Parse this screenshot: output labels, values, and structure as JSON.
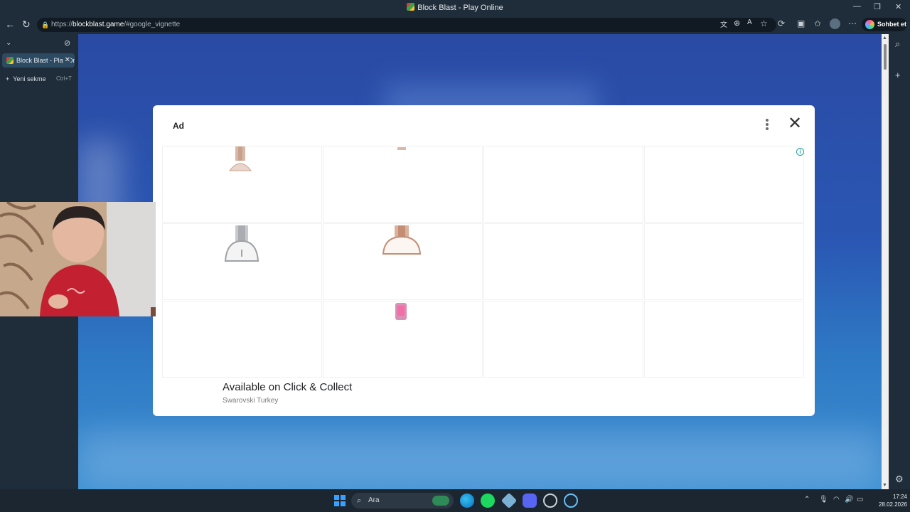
{
  "window": {
    "title": "Block Blast - Play Online",
    "minimize": "—",
    "maximize": "❐",
    "close": "✕"
  },
  "address": {
    "scheme": "https://",
    "host": "blockblast.game",
    "path": "/#google_vignette",
    "copilot_label": "Sohbet et"
  },
  "tabs": [
    {
      "label": "Block Blast - Play Online",
      "close": "✕"
    }
  ],
  "new_tab": {
    "label": "Yeni sekme",
    "shortcut": "Ctrl+T",
    "icon": "+"
  },
  "ad": {
    "label": "Ad",
    "headline": "Available on Click & Collect",
    "advertiser": "Swarovski Turkey",
    "info": "i",
    "close": "✕"
  },
  "taskbar": {
    "search_placeholder": "Ara",
    "time": "17:24",
    "date": "28.02.2026"
  },
  "icons": [
    "back-icon",
    "refresh-icon",
    "lock-icon",
    "translate-icon",
    "zoom-icon",
    "read-aloud-icon",
    "favorite-icon",
    "extensions-icon",
    "collections-icon",
    "favorites-bar-icon",
    "profile-icon",
    "more-icon",
    "search-icon",
    "add-icon",
    "settings-icon",
    "windows-start-icon",
    "edge-icon",
    "spotify-icon",
    "app-icon",
    "discord-icon",
    "steam-icon"
  ],
  "colors": {
    "frame": "#1f2d3a",
    "page_bg": "#2a57b3",
    "modal_bg": "#ffffff",
    "info_teal": "#1ea1a1"
  }
}
